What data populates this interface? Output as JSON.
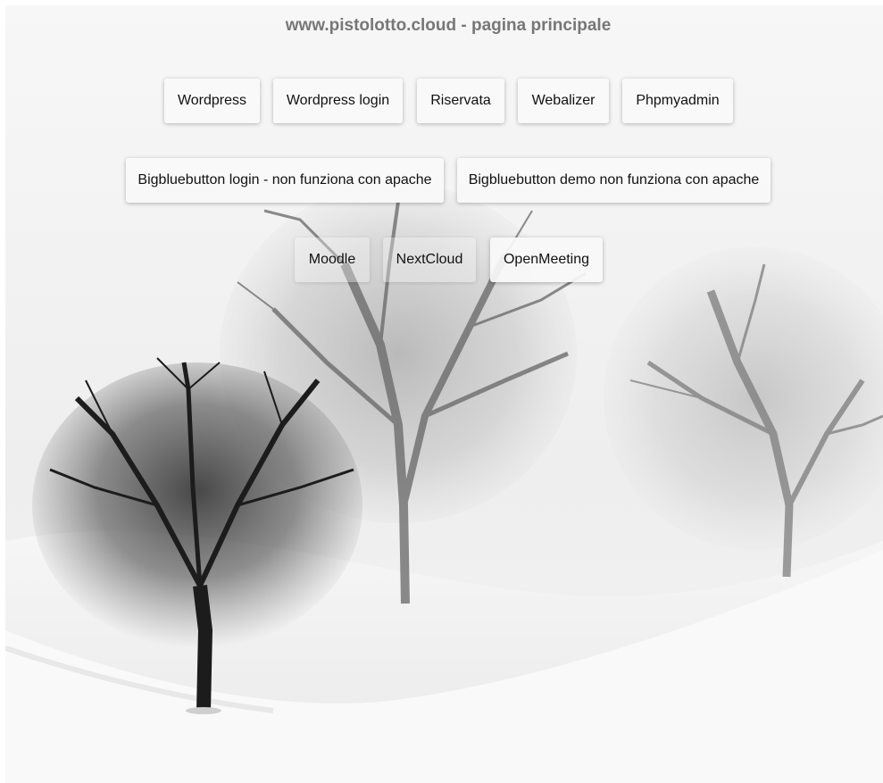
{
  "page": {
    "title": "www.pistolotto.cloud - pagina principale"
  },
  "nav": {
    "row1": [
      {
        "label": "Wordpress"
      },
      {
        "label": "Wordpress login"
      },
      {
        "label": "Riservata"
      },
      {
        "label": "Webalizer"
      },
      {
        "label": "Phpmyadmin"
      }
    ],
    "row2": [
      {
        "label": "Bigbluebutton login - non funziona con apache"
      },
      {
        "label": "Bigbluebutton demo non funziona con apache"
      }
    ],
    "row3": [
      {
        "label": "Moodle"
      },
      {
        "label": "NextCloud"
      },
      {
        "label": "OpenMeeting"
      }
    ]
  },
  "theme": {
    "title_color": "#777777",
    "button_bg": "#f8f8f8",
    "button_text": "#111111"
  }
}
